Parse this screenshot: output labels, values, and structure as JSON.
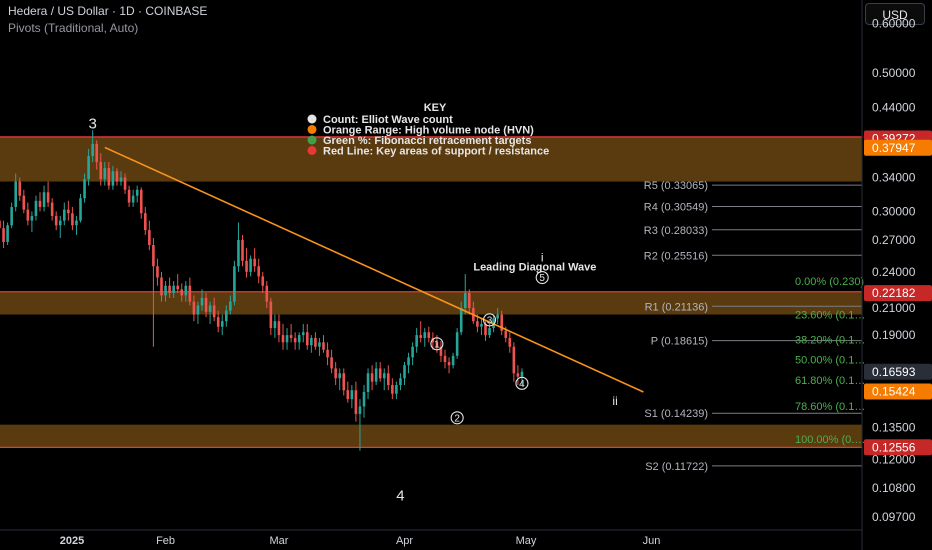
{
  "header": {
    "title": "Hedera / US Dollar · 1D · COINBASE",
    "indicator": "Pivots (Traditional, Auto)",
    "currency_button": "USD"
  },
  "colors": {
    "background": "#000000",
    "candle_up": "#26a69a",
    "candle_down": "#ef5350",
    "hvn_zone": "#6a4412",
    "support_line": "#e53935",
    "trendline": "#f7931a",
    "fib_text": "#4caf50",
    "pivot_text": "#b2b5be",
    "price_tag_red": "#c62828",
    "price_tag_orange": "#f57c00",
    "price_tag_neutral": "#2a2e39"
  },
  "chart_data": {
    "type": "candlestick",
    "y_scale": "log",
    "ylim": [
      0.0925,
      0.655
    ],
    "y_ticks": [
      "0.60000",
      "0.50000",
      "0.44000",
      "0.39272",
      "0.37947",
      "0.34000",
      "0.30000",
      "0.27000",
      "0.24000",
      "0.22182",
      "0.21000",
      "0.19000",
      "0.16593",
      "0.15424",
      "0.13500",
      "0.12556",
      "0.12000",
      "0.10800",
      "0.09700"
    ],
    "y_tick_values": [
      0.6,
      0.5,
      0.44,
      0.39272,
      0.37947,
      0.34,
      0.3,
      0.27,
      0.24,
      0.22182,
      0.21,
      0.19,
      0.16593,
      0.15424,
      0.135,
      0.12556,
      0.12,
      0.108,
      0.097
    ],
    "x_ticks": [
      {
        "label": "2025",
        "day": 0
      },
      {
        "label": "Feb",
        "day": 31
      },
      {
        "label": "Mar",
        "day": 59
      },
      {
        "label": "Apr",
        "day": 90
      },
      {
        "label": "May",
        "day": 120
      },
      {
        "label": "Jun",
        "day": 151
      }
    ],
    "price_tags": [
      {
        "value": 0.39272,
        "label": "0.39272",
        "style": "red"
      },
      {
        "value": 0.37947,
        "label": "0.37947",
        "style": "orange"
      },
      {
        "value": 0.22182,
        "label": "0.22182",
        "style": "red"
      },
      {
        "value": 0.16593,
        "label": "0.16593",
        "style": "neutral"
      },
      {
        "value": 0.15424,
        "label": "0.15424",
        "style": "orange"
      },
      {
        "value": 0.12556,
        "label": "0.12556",
        "style": "red"
      }
    ],
    "zones": [
      {
        "low": 0.335,
        "high": 0.395
      },
      {
        "low": 0.205,
        "high": 0.223
      },
      {
        "low": 0.1255,
        "high": 0.1365
      }
    ],
    "red_lines": [
      0.395,
      0.223,
      0.1255
    ],
    "trendline": {
      "from": {
        "day": 16,
        "price": 0.38
      },
      "to": {
        "day": 149,
        "price": 0.154
      }
    },
    "pivots": [
      {
        "label": "R5 (0.33065)",
        "value": 0.33065
      },
      {
        "label": "R4 (0.30549)",
        "value": 0.30549
      },
      {
        "label": "R3 (0.28033)",
        "value": 0.28033
      },
      {
        "label": "R2 (0.25516)",
        "value": 0.25516
      },
      {
        "label": "R1 (0.21136)",
        "value": 0.21136
      },
      {
        "label": "P (0.18615)",
        "value": 0.18615
      },
      {
        "label": "S1 (0.14239)",
        "value": 0.14239
      },
      {
        "label": "S2 (0.11722)",
        "value": 0.11722
      }
    ],
    "fibs": [
      {
        "label": "0.00% (0.230)",
        "value": 0.232
      },
      {
        "label": "23.60% (0.1…",
        "value": 0.205
      },
      {
        "label": "38.20% (0.1…",
        "value": 0.187
      },
      {
        "label": "50.00% (0.1…",
        "value": 0.1735
      },
      {
        "label": "61.80% (0.1…",
        "value": 0.161
      },
      {
        "label": "78.60% (0.1…",
        "value": 0.1462
      },
      {
        "label": "100.00% (0.…",
        "value": 0.1295
      }
    ],
    "wave_labels": [
      {
        "text": "3",
        "day": 13,
        "price": 0.415,
        "style": "plain"
      },
      {
        "text": "4",
        "day": 89,
        "price": 0.105,
        "style": "plain"
      },
      {
        "text": "1",
        "day": 98,
        "price": 0.184,
        "style": "circle"
      },
      {
        "text": "2",
        "day": 103,
        "price": 0.14,
        "style": "circle"
      },
      {
        "text": "3",
        "day": 111,
        "price": 0.201,
        "style": "circle"
      },
      {
        "text": "4",
        "day": 119,
        "price": 0.159,
        "style": "circle"
      },
      {
        "text": "5",
        "day": 124,
        "price": 0.235,
        "style": "circle"
      },
      {
        "text": "i",
        "day": 124,
        "price": 0.253,
        "style": "small"
      },
      {
        "text": "ii",
        "day": 142,
        "price": 0.149,
        "style": "small"
      }
    ],
    "annotation": {
      "text": "Leading Diagonal Wave",
      "day": 107,
      "price": 0.245
    },
    "legend": {
      "title": "KEY",
      "items": [
        {
          "color": "#e6e6e6",
          "text": "Count: Elliot Wave count"
        },
        {
          "color": "#f57c00",
          "text": "Orange Range: High volume node (HVN)"
        },
        {
          "color": "#43a047",
          "text": "Green %: Fibonacci retracement targets"
        },
        {
          "color": "#e53935",
          "text": "Red Line: Key areas of support / resistance"
        }
      ]
    },
    "candles": {
      "start_day": -12,
      "ohlc": [
        [
          0.285,
          0.302,
          0.28,
          0.297
        ],
        [
          0.297,
          0.305,
          0.285,
          0.29
        ],
        [
          0.29,
          0.298,
          0.278,
          0.282
        ],
        [
          0.282,
          0.29,
          0.262,
          0.268
        ],
        [
          0.268,
          0.288,
          0.265,
          0.285
        ],
        [
          0.285,
          0.31,
          0.282,
          0.305
        ],
        [
          0.305,
          0.345,
          0.3,
          0.335
        ],
        [
          0.335,
          0.34,
          0.312,
          0.318
        ],
        [
          0.318,
          0.325,
          0.298,
          0.302
        ],
        [
          0.302,
          0.31,
          0.285,
          0.29
        ],
        [
          0.29,
          0.3,
          0.278,
          0.295
        ],
        [
          0.295,
          0.318,
          0.29,
          0.312
        ],
        [
          0.312,
          0.322,
          0.3,
          0.305
        ],
        [
          0.305,
          0.33,
          0.3,
          0.322
        ],
        [
          0.322,
          0.335,
          0.305,
          0.31
        ],
        [
          0.31,
          0.315,
          0.29,
          0.295
        ],
        [
          0.295,
          0.3,
          0.28,
          0.285
        ],
        [
          0.285,
          0.295,
          0.272,
          0.29
        ],
        [
          0.29,
          0.31,
          0.285,
          0.302
        ],
        [
          0.302,
          0.312,
          0.29,
          0.298
        ],
        [
          0.298,
          0.305,
          0.28,
          0.285
        ],
        [
          0.285,
          0.295,
          0.275,
          0.29
        ],
        [
          0.29,
          0.32,
          0.288,
          0.315
        ],
        [
          0.315,
          0.345,
          0.31,
          0.338
        ],
        [
          0.338,
          0.378,
          0.33,
          0.368
        ],
        [
          0.368,
          0.405,
          0.36,
          0.385
        ],
        [
          0.385,
          0.39,
          0.35,
          0.36
        ],
        [
          0.36,
          0.372,
          0.33,
          0.338
        ],
        [
          0.338,
          0.36,
          0.33,
          0.352
        ],
        [
          0.352,
          0.36,
          0.325,
          0.33
        ],
        [
          0.33,
          0.355,
          0.325,
          0.348
        ],
        [
          0.348,
          0.352,
          0.33,
          0.335
        ],
        [
          0.335,
          0.348,
          0.33,
          0.34
        ],
        [
          0.34,
          0.345,
          0.32,
          0.325
        ],
        [
          0.325,
          0.33,
          0.305,
          0.31
        ],
        [
          0.31,
          0.325,
          0.305,
          0.318
        ],
        [
          0.318,
          0.33,
          0.31,
          0.325
        ],
        [
          0.325,
          0.328,
          0.292,
          0.298
        ],
        [
          0.298,
          0.305,
          0.275,
          0.28
        ],
        [
          0.28,
          0.29,
          0.26,
          0.265
        ],
        [
          0.265,
          0.272,
          0.182,
          0.245
        ],
        [
          0.245,
          0.252,
          0.228,
          0.235
        ],
        [
          0.235,
          0.24,
          0.215,
          0.22
        ],
        [
          0.22,
          0.232,
          0.215,
          0.228
        ],
        [
          0.228,
          0.235,
          0.218,
          0.222
        ],
        [
          0.222,
          0.232,
          0.218,
          0.228
        ],
        [
          0.228,
          0.238,
          0.222,
          0.225
        ],
        [
          0.225,
          0.23,
          0.215,
          0.22
        ],
        [
          0.22,
          0.232,
          0.215,
          0.228
        ],
        [
          0.228,
          0.235,
          0.212,
          0.215
        ],
        [
          0.215,
          0.22,
          0.2,
          0.205
        ],
        [
          0.205,
          0.215,
          0.198,
          0.212
        ],
        [
          0.212,
          0.225,
          0.208,
          0.218
        ],
        [
          0.218,
          0.222,
          0.203,
          0.207
        ],
        [
          0.207,
          0.215,
          0.198,
          0.212
        ],
        [
          0.212,
          0.218,
          0.2,
          0.203
        ],
        [
          0.203,
          0.208,
          0.192,
          0.196
        ],
        [
          0.196,
          0.205,
          0.19,
          0.2
        ],
        [
          0.2,
          0.212,
          0.196,
          0.208
        ],
        [
          0.208,
          0.22,
          0.205,
          0.215
        ],
        [
          0.215,
          0.25,
          0.212,
          0.245
        ],
        [
          0.245,
          0.288,
          0.24,
          0.27
        ],
        [
          0.27,
          0.275,
          0.245,
          0.25
        ],
        [
          0.25,
          0.262,
          0.235,
          0.24
        ],
        [
          0.24,
          0.255,
          0.236,
          0.252
        ],
        [
          0.252,
          0.262,
          0.24,
          0.245
        ],
        [
          0.245,
          0.252,
          0.23,
          0.236
        ],
        [
          0.236,
          0.24,
          0.222,
          0.228
        ],
        [
          0.228,
          0.232,
          0.21,
          0.215
        ],
        [
          0.215,
          0.218,
          0.19,
          0.195
        ],
        [
          0.195,
          0.205,
          0.188,
          0.2
        ],
        [
          0.2,
          0.205,
          0.185,
          0.19
        ],
        [
          0.19,
          0.198,
          0.18,
          0.185
        ],
        [
          0.185,
          0.195,
          0.18,
          0.19
        ],
        [
          0.19,
          0.198,
          0.185,
          0.188
        ],
        [
          0.188,
          0.192,
          0.18,
          0.185
        ],
        [
          0.185,
          0.192,
          0.18,
          0.19
        ],
        [
          0.19,
          0.198,
          0.185,
          0.192
        ],
        [
          0.192,
          0.198,
          0.18,
          0.183
        ],
        [
          0.183,
          0.19,
          0.178,
          0.188
        ],
        [
          0.188,
          0.192,
          0.18,
          0.182
        ],
        [
          0.182,
          0.188,
          0.176,
          0.185
        ],
        [
          0.185,
          0.19,
          0.178,
          0.18
        ],
        [
          0.18,
          0.185,
          0.17,
          0.175
        ],
        [
          0.175,
          0.18,
          0.165,
          0.168
        ],
        [
          0.168,
          0.172,
          0.158,
          0.162
        ],
        [
          0.162,
          0.168,
          0.155,
          0.165
        ],
        [
          0.165,
          0.168,
          0.152,
          0.155
        ],
        [
          0.155,
          0.16,
          0.148,
          0.15
        ],
        [
          0.15,
          0.158,
          0.145,
          0.155
        ],
        [
          0.155,
          0.16,
          0.138,
          0.142
        ],
        [
          0.142,
          0.15,
          0.124,
          0.146
        ],
        [
          0.146,
          0.158,
          0.14,
          0.154
        ],
        [
          0.154,
          0.168,
          0.15,
          0.165
        ],
        [
          0.165,
          0.17,
          0.155,
          0.16
        ],
        [
          0.16,
          0.172,
          0.158,
          0.168
        ],
        [
          0.168,
          0.172,
          0.16,
          0.162
        ],
        [
          0.162,
          0.168,
          0.155,
          0.165
        ],
        [
          0.165,
          0.17,
          0.155,
          0.158
        ],
        [
          0.158,
          0.162,
          0.15,
          0.153
        ],
        [
          0.153,
          0.16,
          0.15,
          0.158
        ],
        [
          0.158,
          0.165,
          0.155,
          0.162
        ],
        [
          0.162,
          0.172,
          0.158,
          0.17
        ],
        [
          0.17,
          0.178,
          0.165,
          0.175
        ],
        [
          0.175,
          0.185,
          0.17,
          0.182
        ],
        [
          0.182,
          0.195,
          0.178,
          0.19
        ],
        [
          0.19,
          0.2,
          0.185,
          0.188
        ],
        [
          0.188,
          0.195,
          0.182,
          0.192
        ],
        [
          0.192,
          0.196,
          0.185,
          0.188
        ],
        [
          0.188,
          0.192,
          0.18,
          0.185
        ],
        [
          0.185,
          0.19,
          0.178,
          0.182
        ],
        [
          0.182,
          0.186,
          0.172,
          0.176
        ],
        [
          0.176,
          0.18,
          0.168,
          0.172
        ],
        [
          0.172,
          0.175,
          0.165,
          0.17
        ],
        [
          0.17,
          0.178,
          0.168,
          0.176
        ],
        [
          0.176,
          0.195,
          0.174,
          0.192
        ],
        [
          0.192,
          0.215,
          0.19,
          0.21
        ],
        [
          0.21,
          0.238,
          0.205,
          0.222
        ],
        [
          0.222,
          0.225,
          0.205,
          0.21
        ],
        [
          0.21,
          0.215,
          0.198,
          0.2
        ],
        [
          0.2,
          0.205,
          0.192,
          0.196
        ],
        [
          0.196,
          0.202,
          0.19,
          0.198
        ],
        [
          0.198,
          0.2,
          0.186,
          0.19
        ],
        [
          0.19,
          0.198,
          0.188,
          0.195
        ],
        [
          0.195,
          0.205,
          0.192,
          0.202
        ],
        [
          0.202,
          0.21,
          0.198,
          0.205
        ],
        [
          0.205,
          0.208,
          0.19,
          0.193
        ],
        [
          0.193,
          0.196,
          0.185,
          0.188
        ],
        [
          0.188,
          0.192,
          0.178,
          0.182
        ],
        [
          0.182,
          0.185,
          0.16,
          0.165
        ],
        [
          0.165,
          0.17,
          0.158,
          0.163
        ],
        [
          0.163,
          0.168,
          0.158,
          0.1659
        ]
      ]
    }
  }
}
